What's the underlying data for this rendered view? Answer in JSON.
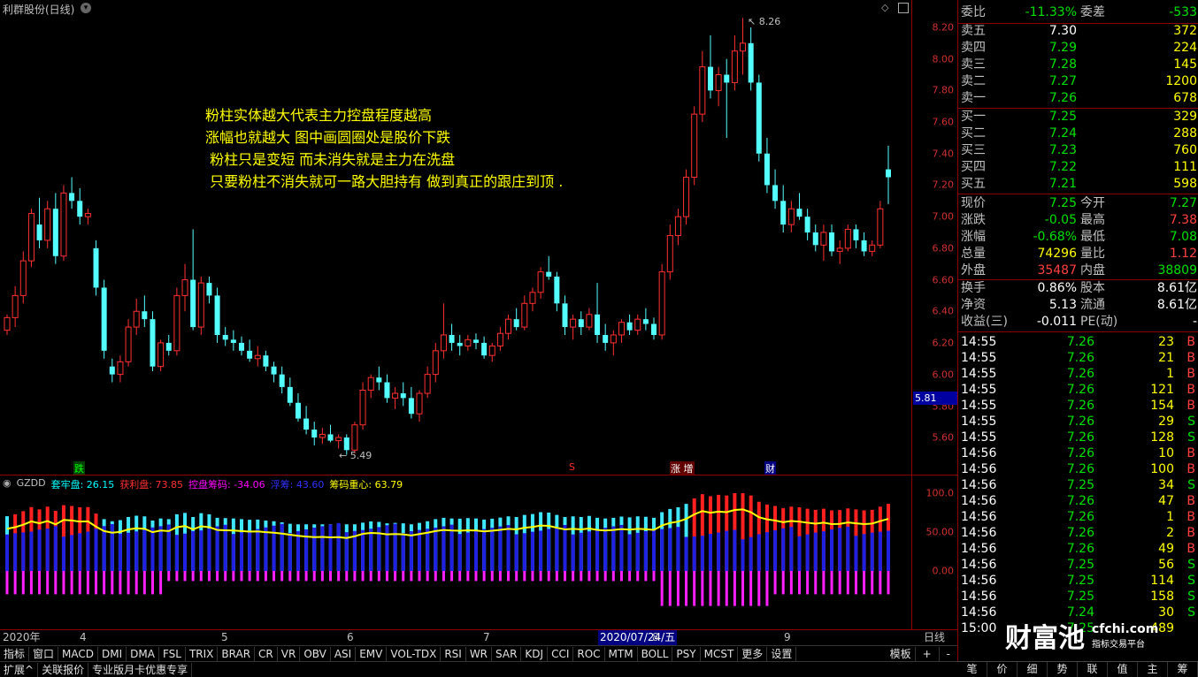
{
  "chart": {
    "title": "利群股份(日线)",
    "annotation_lines": [
      "粉柱实体越大代表主力控盘程度越高",
      "涨幅也就越大 图中画圆圈处是股价下跌",
      " 粉柱只是变短 而未消失就是主力在洗盘",
      " 只要粉柱不消失就可一路大胆持有 做到真正的跟庄到顶 ."
    ],
    "high_label": "8.26",
    "low_label": "5.49",
    "current_price_tag": "5.81",
    "event_markers": [
      "跌",
      "S",
      "涨 增",
      "财"
    ],
    "price_ticks": [
      "8.20",
      "8.00",
      "7.80",
      "7.60",
      "7.40",
      "7.20",
      "7.00",
      "6.80",
      "6.60",
      "6.40",
      "6.20",
      "6.00",
      "5.80",
      "5.60"
    ]
  },
  "indicator": {
    "name": "GZDD",
    "items": [
      {
        "label": "套牢盘: 26.15",
        "color": "#00ffff"
      },
      {
        "label": "获利盘: 73.85",
        "color": "#ff3030"
      },
      {
        "label": "控盘筹码: -34.06",
        "color": "#ff00ff"
      },
      {
        "label": "浮筹: 43.60",
        "color": "#3030ff"
      },
      {
        "label": "筹码重心: 63.79",
        "color": "#ffff00"
      }
    ],
    "ticks": [
      "100.0",
      "50.00",
      "0.00"
    ]
  },
  "time_axis": {
    "labels": [
      "2020年",
      "4",
      "5",
      "6",
      "7",
      "2020/07/24/五",
      "8",
      "9"
    ],
    "period": "日线"
  },
  "tabs": [
    "指标",
    "窗口",
    "MACD",
    "DMI",
    "DMA",
    "FSL",
    "TRIX",
    "BRAR",
    "CR",
    "VR",
    "OBV",
    "ASI",
    "EMV",
    "VOL-TDX",
    "RSI",
    "WR",
    "SAR",
    "KDJ",
    "CCI",
    "ROC",
    "MTM",
    "BOLL",
    "PSY",
    "MCST",
    "更多",
    "设置"
  ],
  "tab_right": [
    "模板",
    "+",
    "-"
  ],
  "bottom_tabs": [
    "扩展^",
    "关联报价",
    "专业版月卡优惠专享"
  ],
  "side": {
    "weibi": {
      "label1": "委比",
      "val1": "-11.33%",
      "label2": "委差",
      "val2": "-533"
    },
    "asks": [
      {
        "label": "卖五",
        "price": "7.30",
        "vol": "372"
      },
      {
        "label": "卖四",
        "price": "7.29",
        "vol": "224"
      },
      {
        "label": "卖三",
        "price": "7.28",
        "vol": "145"
      },
      {
        "label": "卖二",
        "price": "7.27",
        "vol": "1200"
      },
      {
        "label": "卖一",
        "price": "7.26",
        "vol": "678"
      }
    ],
    "bids": [
      {
        "label": "买一",
        "price": "7.25",
        "vol": "329"
      },
      {
        "label": "买二",
        "price": "7.24",
        "vol": "288"
      },
      {
        "label": "买三",
        "price": "7.23",
        "vol": "760"
      },
      {
        "label": "买四",
        "price": "7.22",
        "vol": "111"
      },
      {
        "label": "买五",
        "price": "7.21",
        "vol": "598"
      }
    ],
    "quote": [
      {
        "l1": "现价",
        "v1": "7.25",
        "c1": "green",
        "l2": "今开",
        "v2": "7.27",
        "c2": "green"
      },
      {
        "l1": "涨跌",
        "v1": "-0.05",
        "c1": "green",
        "l2": "最高",
        "v2": "7.38",
        "c2": "red"
      },
      {
        "l1": "涨幅",
        "v1": "-0.68%",
        "c1": "green",
        "l2": "最低",
        "v2": "7.08",
        "c2": "green"
      },
      {
        "l1": "总量",
        "v1": "74296",
        "c1": "yellow",
        "l2": "量比",
        "v2": "1.12",
        "c2": "red"
      },
      {
        "l1": "外盘",
        "v1": "35487",
        "c1": "red",
        "l2": "内盘",
        "v2": "38809",
        "c2": "green"
      }
    ],
    "stats": [
      {
        "l1": "换手",
        "v1": "0.86%",
        "l2": "股本",
        "v2": "8.61亿"
      },
      {
        "l1": "净资",
        "v1": "5.13",
        "l2": "流通",
        "v2": "8.61亿"
      },
      {
        "l1": "收益(三)",
        "v1": "-0.011",
        "l2": "PE(动)",
        "v2": "-"
      }
    ],
    "ticks": [
      {
        "t": "14:55",
        "p": "7.26",
        "v": "23",
        "s": "B"
      },
      {
        "t": "14:55",
        "p": "7.26",
        "v": "21",
        "s": "B"
      },
      {
        "t": "14:55",
        "p": "7.26",
        "v": "1",
        "s": "B"
      },
      {
        "t": "14:55",
        "p": "7.26",
        "v": "121",
        "s": "B"
      },
      {
        "t": "14:55",
        "p": "7.26",
        "v": "154",
        "s": "B"
      },
      {
        "t": "14:55",
        "p": "7.26",
        "v": "29",
        "s": "S"
      },
      {
        "t": "14:55",
        "p": "7.26",
        "v": "128",
        "s": "S"
      },
      {
        "t": "14:56",
        "p": "7.26",
        "v": "10",
        "s": "B"
      },
      {
        "t": "14:56",
        "p": "7.26",
        "v": "100",
        "s": "B"
      },
      {
        "t": "14:56",
        "p": "7.25",
        "v": "34",
        "s": "S"
      },
      {
        "t": "14:56",
        "p": "7.26",
        "v": "47",
        "s": "B"
      },
      {
        "t": "14:56",
        "p": "7.26",
        "v": "1",
        "s": "B"
      },
      {
        "t": "14:56",
        "p": "7.26",
        "v": "2",
        "s": "B"
      },
      {
        "t": "14:56",
        "p": "7.26",
        "v": "49",
        "s": "B"
      },
      {
        "t": "14:56",
        "p": "7.25",
        "v": "56",
        "s": "S"
      },
      {
        "t": "14:56",
        "p": "7.25",
        "v": "114",
        "s": "S"
      },
      {
        "t": "14:56",
        "p": "7.25",
        "v": "158",
        "s": "S"
      },
      {
        "t": "14:56",
        "p": "7.24",
        "v": "30",
        "s": "S"
      },
      {
        "t": "15:00",
        "p": "7.25",
        "v": "489",
        "s": ""
      }
    ],
    "bottom_tabs": [
      "笔",
      "价",
      "细",
      "势",
      "联",
      "值",
      "主",
      "筹"
    ]
  },
  "watermark": {
    "brand": "财富池",
    "site": "cfchi.com",
    "sub": "指标交易平台"
  },
  "colors": {
    "up": "#ff3030",
    "down": "#54ffff",
    "bg": "#000000",
    "grid": "#8b0000"
  },
  "chart_data": {
    "type": "candlestick",
    "ylim": [
      5.45,
      8.3
    ],
    "candles": [
      [
        6.28,
        6.38,
        6.25,
        6.36
      ],
      [
        6.36,
        6.56,
        6.3,
        6.5
      ],
      [
        6.5,
        6.78,
        6.45,
        6.72
      ],
      [
        6.72,
        7.05,
        6.68,
        7.02
      ],
      [
        6.95,
        7.12,
        6.8,
        6.85
      ],
      [
        6.85,
        7.1,
        6.8,
        7.05
      ],
      [
        7.05,
        7.15,
        6.7,
        6.75
      ],
      [
        6.75,
        7.2,
        6.72,
        7.15
      ],
      [
        7.15,
        7.25,
        7.05,
        7.1
      ],
      [
        7.1,
        7.18,
        6.95,
        7.0
      ],
      [
        7.0,
        7.05,
        6.95,
        7.02
      ],
      [
        6.8,
        6.85,
        6.5,
        6.55
      ],
      [
        6.55,
        6.6,
        6.1,
        6.15
      ],
      [
        6.05,
        6.1,
        5.95,
        6.0
      ],
      [
        6.0,
        6.12,
        5.95,
        6.08
      ],
      [
        6.08,
        6.35,
        6.05,
        6.3
      ],
      [
        6.3,
        6.48,
        6.25,
        6.4
      ],
      [
        6.4,
        6.5,
        6.3,
        6.35
      ],
      [
        6.35,
        6.4,
        6.02,
        6.05
      ],
      [
        6.05,
        6.22,
        6.02,
        6.2
      ],
      [
        6.2,
        6.25,
        6.12,
        6.15
      ],
      [
        6.15,
        6.55,
        6.12,
        6.5
      ],
      [
        6.5,
        6.7,
        6.4,
        6.6
      ],
      [
        6.6,
        6.92,
        6.28,
        6.3
      ],
      [
        6.3,
        6.62,
        6.25,
        6.58
      ],
      [
        6.58,
        6.62,
        6.45,
        6.5
      ],
      [
        6.5,
        6.55,
        6.2,
        6.25
      ],
      [
        6.25,
        6.3,
        6.18,
        6.22
      ],
      [
        6.22,
        6.28,
        6.15,
        6.2
      ],
      [
        6.2,
        6.24,
        6.12,
        6.15
      ],
      [
        6.15,
        6.22,
        6.08,
        6.1
      ],
      [
        6.1,
        6.18,
        6.05,
        6.12
      ],
      [
        6.12,
        6.15,
        6.02,
        6.05
      ],
      [
        6.05,
        6.08,
        5.95,
        6.0
      ],
      [
        6.0,
        6.05,
        5.88,
        5.92
      ],
      [
        5.92,
        5.98,
        5.8,
        5.82
      ],
      [
        5.82,
        5.88,
        5.7,
        5.72
      ],
      [
        5.72,
        5.8,
        5.62,
        5.65
      ],
      [
        5.65,
        5.7,
        5.55,
        5.6
      ],
      [
        5.6,
        5.66,
        5.56,
        5.62
      ],
      [
        5.62,
        5.68,
        5.57,
        5.58
      ],
      [
        5.58,
        5.62,
        5.53,
        5.6
      ],
      [
        5.6,
        5.62,
        5.49,
        5.52
      ],
      [
        5.52,
        5.7,
        5.5,
        5.68
      ],
      [
        5.68,
        5.95,
        5.65,
        5.9
      ],
      [
        5.9,
        6.0,
        5.85,
        5.98
      ],
      [
        5.98,
        6.05,
        5.9,
        5.95
      ],
      [
        5.95,
        6.0,
        5.82,
        5.85
      ],
      [
        5.85,
        5.92,
        5.78,
        5.88
      ],
      [
        5.88,
        5.95,
        5.8,
        5.85
      ],
      [
        5.85,
        5.92,
        5.72,
        5.75
      ],
      [
        5.75,
        5.9,
        5.7,
        5.88
      ],
      [
        5.88,
        6.05,
        5.85,
        6.0
      ],
      [
        6.0,
        6.2,
        5.95,
        6.15
      ],
      [
        6.15,
        6.45,
        6.1,
        6.25
      ],
      [
        6.25,
        6.32,
        6.15,
        6.2
      ],
      [
        6.2,
        6.25,
        6.12,
        6.18
      ],
      [
        6.18,
        6.25,
        6.15,
        6.22
      ],
      [
        6.22,
        6.26,
        6.16,
        6.2
      ],
      [
        6.2,
        6.24,
        6.1,
        6.12
      ],
      [
        6.12,
        6.2,
        6.08,
        6.18
      ],
      [
        6.18,
        6.3,
        6.15,
        6.26
      ],
      [
        6.26,
        6.38,
        6.22,
        6.35
      ],
      [
        6.35,
        6.42,
        6.28,
        6.3
      ],
      [
        6.3,
        6.5,
        6.28,
        6.45
      ],
      [
        6.45,
        6.55,
        6.4,
        6.52
      ],
      [
        6.52,
        6.68,
        6.48,
        6.65
      ],
      [
        6.65,
        6.75,
        6.6,
        6.62
      ],
      [
        6.62,
        6.65,
        6.4,
        6.45
      ],
      [
        6.45,
        6.5,
        6.25,
        6.3
      ],
      [
        6.3,
        6.38,
        6.22,
        6.35
      ],
      [
        6.35,
        6.4,
        6.25,
        6.3
      ],
      [
        6.3,
        6.42,
        6.28,
        6.38
      ],
      [
        6.38,
        6.58,
        6.2,
        6.25
      ],
      [
        6.25,
        6.32,
        6.15,
        6.2
      ],
      [
        6.2,
        6.28,
        6.12,
        6.25
      ],
      [
        6.25,
        6.35,
        6.2,
        6.33
      ],
      [
        6.33,
        6.38,
        6.25,
        6.28
      ],
      [
        6.28,
        6.38,
        6.25,
        6.35
      ],
      [
        6.35,
        6.42,
        6.28,
        6.32
      ],
      [
        6.32,
        6.36,
        6.22,
        6.25
      ],
      [
        6.25,
        6.7,
        6.22,
        6.65
      ],
      [
        6.65,
        6.95,
        6.6,
        6.88
      ],
      [
        6.88,
        7.05,
        6.82,
        7.0
      ],
      [
        7.0,
        7.3,
        6.95,
        7.25
      ],
      [
        7.25,
        7.7,
        7.2,
        7.65
      ],
      [
        7.65,
        8.05,
        7.6,
        7.95
      ],
      [
        7.95,
        8.15,
        7.75,
        7.8
      ],
      [
        7.8,
        7.95,
        7.7,
        7.9
      ],
      [
        7.9,
        8.0,
        7.5,
        7.85
      ],
      [
        7.85,
        8.15,
        7.8,
        8.05
      ],
      [
        8.05,
        8.26,
        7.9,
        8.1
      ],
      [
        8.1,
        8.2,
        7.8,
        7.85
      ],
      [
        7.85,
        7.9,
        7.35,
        7.4
      ],
      [
        7.4,
        7.5,
        7.15,
        7.2
      ],
      [
        7.2,
        7.3,
        7.05,
        7.1
      ],
      [
        7.1,
        7.2,
        6.9,
        6.95
      ],
      [
        6.95,
        7.1,
        6.9,
        7.05
      ],
      [
        7.05,
        7.15,
        6.98,
        7.0
      ],
      [
        7.0,
        7.05,
        6.85,
        6.9
      ],
      [
        6.9,
        6.95,
        6.78,
        6.82
      ],
      [
        6.82,
        6.95,
        6.72,
        6.9
      ],
      [
        6.9,
        6.95,
        6.75,
        6.78
      ],
      [
        6.78,
        6.85,
        6.7,
        6.8
      ],
      [
        6.8,
        6.95,
        6.78,
        6.92
      ],
      [
        6.92,
        6.95,
        6.8,
        6.85
      ],
      [
        6.85,
        6.9,
        6.75,
        6.78
      ],
      [
        6.78,
        6.85,
        6.75,
        6.82
      ],
      [
        6.82,
        7.1,
        6.8,
        7.05
      ],
      [
        7.3,
        7.45,
        7.08,
        7.25
      ]
    ]
  }
}
